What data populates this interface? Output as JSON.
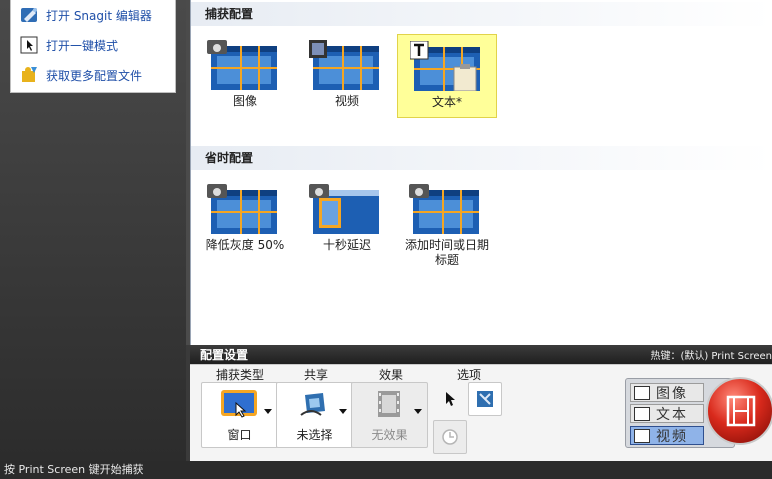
{
  "quick_menu": {
    "items": [
      {
        "label": "打开 Snagit 编辑器",
        "icon": "snagit-editor-icon"
      },
      {
        "label": "打开一键模式",
        "icon": "one-click-icon"
      },
      {
        "label": "获取更多配置文件",
        "icon": "puzzle-icon"
      }
    ]
  },
  "capture_profiles": {
    "title": "捕获配置",
    "items": [
      {
        "label": "图像",
        "icon": "camera-icon",
        "selected": false
      },
      {
        "label": "视频",
        "icon": "film-icon",
        "selected": false
      },
      {
        "label": "文本*",
        "icon": "text-icon",
        "selected": true
      }
    ]
  },
  "timesaver_profiles": {
    "title": "省时配置",
    "items": [
      {
        "label": "降低灰度 50%",
        "icon": "camera-icon"
      },
      {
        "label": "十秒延迟",
        "icon": "camera-icon"
      },
      {
        "label": "添加时间或日期\n标题",
        "icon": "camera-icon"
      }
    ]
  },
  "settings": {
    "title": "配置设置",
    "hotkey": "热键：(默认) Print  Screen",
    "capture_type": {
      "label": "捕获类型",
      "value": "窗口"
    },
    "share": {
      "label": "共享",
      "value": "未选择"
    },
    "effects": {
      "label": "效果",
      "value": "无效果"
    },
    "options": {
      "label": "选项"
    }
  },
  "modes": {
    "items": [
      {
        "label": "图像",
        "icon": "camera-icon",
        "active": false
      },
      {
        "label": "文本",
        "icon": "text-icon",
        "active": false
      },
      {
        "label": "视频",
        "icon": "film-icon",
        "active": true
      }
    ]
  },
  "status_bar": {
    "text": "按  Print Screen  键开始捕获"
  },
  "colors": {
    "accent_blue": "#1f4fa8",
    "selected_bg": "#ffff99",
    "capture_red": "#d92a1c"
  }
}
